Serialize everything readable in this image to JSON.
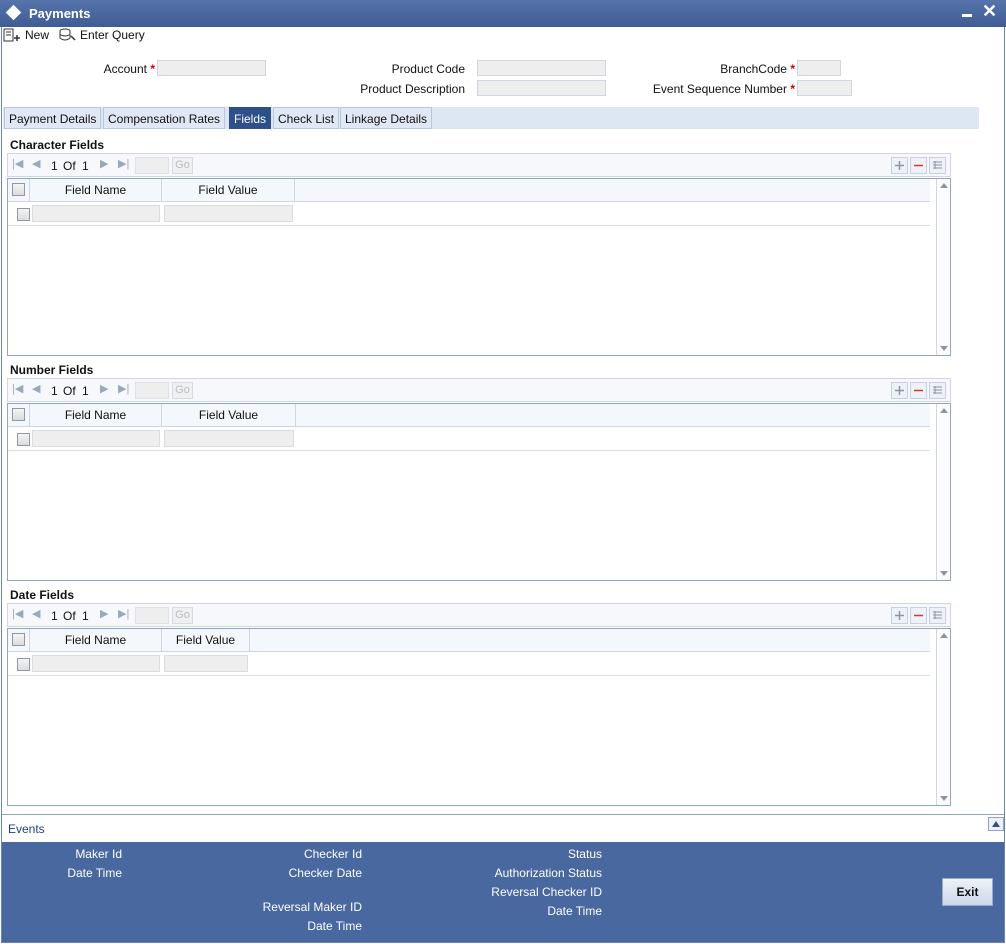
{
  "window": {
    "title": "Payments"
  },
  "toolbar": {
    "new_label": "New",
    "enter_query_label": "Enter Query"
  },
  "header": {
    "account_label": "Account",
    "product_code_label": "Product Code",
    "product_description_label": "Product Description",
    "branch_code_label": "BranchCode",
    "event_seq_label": "Event Sequence Number",
    "required_mark": "*"
  },
  "tabs": [
    {
      "label": "Payment Details"
    },
    {
      "label": "Compensation Rates"
    },
    {
      "label": "Fields",
      "active": true
    },
    {
      "label": "Check List"
    },
    {
      "label": "Linkage Details"
    }
  ],
  "sections": {
    "character": {
      "title": "Character Fields",
      "page": "1",
      "of": "Of",
      "total": "1",
      "go": "Go",
      "col_name": "Field Name",
      "col_value": "Field Value"
    },
    "number": {
      "title": "Number Fields",
      "page": "1",
      "of": "Of",
      "total": "1",
      "go": "Go",
      "col_name": "Field Name",
      "col_value": "Field Value"
    },
    "date": {
      "title": "Date Fields",
      "page": "1",
      "of": "Of",
      "total": "1",
      "go": "Go",
      "col_name": "Field Name",
      "col_value": "Field Value"
    }
  },
  "events": {
    "label": "Events"
  },
  "footer": {
    "maker_id": "Maker Id",
    "date_time": "Date Time",
    "checker_id": "Checker Id",
    "checker_date": "Checker Date",
    "reversal_maker_id": "Reversal Maker ID",
    "date_time_2": "Date Time",
    "status": "Status",
    "authorization_status": "Authorization Status",
    "reversal_checker_id": "Reversal Checker ID",
    "date_time_3": "Date Time",
    "exit_label": "Exit"
  },
  "colors": {
    "title_bar": "#3f5c95",
    "active_tab": "#2d4f8a",
    "footer": "#48689f"
  }
}
